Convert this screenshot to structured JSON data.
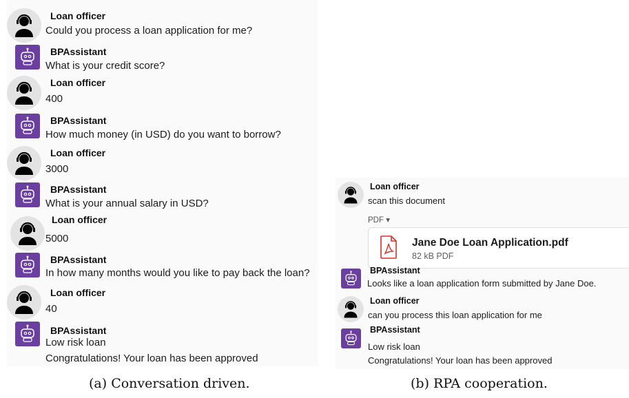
{
  "panel_a": {
    "messages": [
      {
        "sender": "Loan officer",
        "text": "Could you process a loan application for me?",
        "avatar": "headset-person-icon"
      },
      {
        "sender": "BPAssistant",
        "text": "What is your credit score?",
        "avatar": "robot-icon"
      },
      {
        "sender": "Loan officer",
        "text": "400",
        "avatar": "headset-person-icon"
      },
      {
        "sender": "BPAssistant",
        "text": "How much money  (in USD) do you want to borrow?",
        "avatar": "robot-icon"
      },
      {
        "sender": "Loan officer",
        "text": "3000",
        "avatar": "headset-person-icon"
      },
      {
        "sender": "BPAssistant",
        "text": "What is your annual salary in USD?",
        "avatar": "robot-icon"
      },
      {
        "sender": "Loan officer",
        "text": "5000",
        "avatar": "headset-person-icon"
      },
      {
        "sender": "BPAssistant",
        "text": "In how many months would you like to pay back the loan?",
        "avatar": "robot-icon"
      },
      {
        "sender": "Loan officer",
        "text": "40",
        "avatar": "headset-person-icon"
      },
      {
        "sender": "BPAssistant",
        "text": "Low risk loan",
        "text2": "Congratulations! Your loan has been approved",
        "avatar": "robot-icon"
      }
    ],
    "caption": "(a) Conversation driven."
  },
  "panel_b": {
    "messages": [
      {
        "sender": "Loan officer",
        "text": "scan this document",
        "avatar": "headset-person-icon"
      },
      {
        "sender": "BPAssistant",
        "text": "Looks like a loan application form submitted by Jane Doe.",
        "avatar": "robot-icon"
      },
      {
        "sender": "Loan officer",
        "text": "can you process this loan application for me",
        "avatar": "headset-person-icon"
      },
      {
        "sender": "BPAssistant",
        "text": "Low risk loan",
        "text2": "Congratulations! Your loan has been approved",
        "avatar": "robot-icon"
      }
    ],
    "attachment": {
      "type_label": "PDF ▾",
      "file_name": "Jane Doe Loan Application.pdf",
      "meta": "82 kB PDF",
      "icon": "pdf-file-icon"
    },
    "caption": "(b) RPA cooperation."
  },
  "colors": {
    "bot_avatar": "#6a3fa0",
    "human_avatar_bg": "#e3e3e3",
    "pdf_red": "#d93025",
    "panel_bg": "#fafafa"
  }
}
